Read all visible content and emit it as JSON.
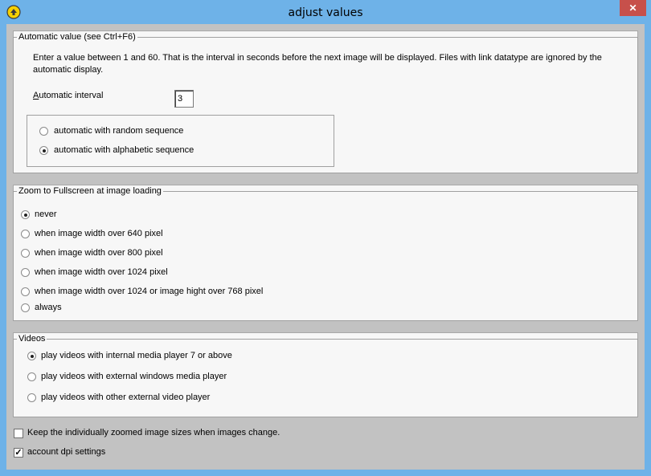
{
  "window": {
    "title": "adjust values"
  },
  "automatic": {
    "legend": "Automatic value (see Ctrl+F6)",
    "description": "Enter a value between 1 and 60. That is the interval in seconds before the next image will be displayed. Files with link datatype are ignored by the automatic display.",
    "interval_label_first": "A",
    "interval_label_rest": "utomatic interval",
    "interval_value": "3",
    "options": [
      {
        "label": "automatic with random sequence",
        "selected": false
      },
      {
        "label": "automatic with alphabetic sequence",
        "selected": true
      }
    ]
  },
  "zoom": {
    "legend": "Zoom to Fullscreen at image loading",
    "options": [
      {
        "label": "never",
        "selected": true
      },
      {
        "label": "when image width over 640 pixel",
        "selected": false
      },
      {
        "label": "when image width over 800 pixel",
        "selected": false
      },
      {
        "label": "when image width over 1024 pixel",
        "selected": false
      },
      {
        "label": "when image width over 1024 or image hight over 768 pixel",
        "selected": false
      },
      {
        "label": "always",
        "selected": false
      }
    ]
  },
  "videos": {
    "legend": "Videos",
    "options": [
      {
        "label": "play videos with internal media player 7 or above",
        "selected": true
      },
      {
        "label": "play videos with external windows media player",
        "selected": false
      },
      {
        "label": "play videos with other external video player",
        "selected": false
      }
    ]
  },
  "checks": [
    {
      "label": "Keep the individually zoomed image sizes when images change.",
      "checked": false
    },
    {
      "label": "account dpi settings",
      "checked": true
    }
  ]
}
